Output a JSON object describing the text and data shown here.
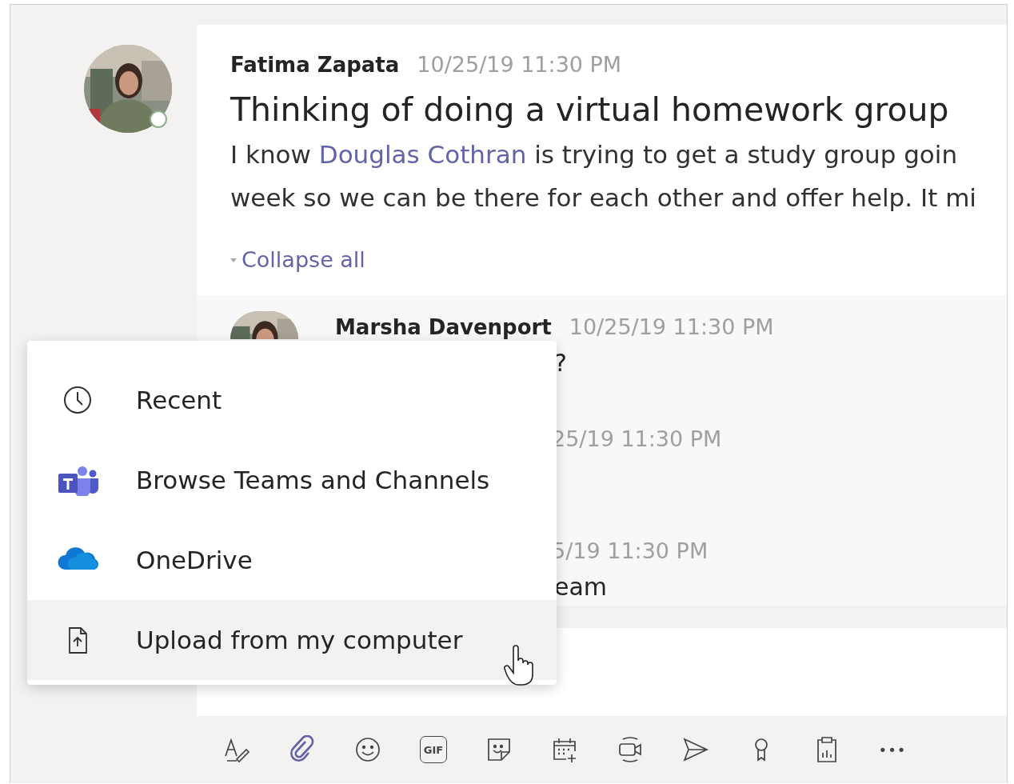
{
  "post": {
    "author": "Fatima Zapata",
    "time": "10/25/19 11:30 PM",
    "online": true,
    "title": "Thinking of doing a virtual homework group",
    "body": [
      {
        "text": "I know "
      },
      {
        "text": "Douglas Cothran",
        "kind": "mention"
      },
      {
        "text": " is trying to get a study group goin"
      }
    ],
    "body_line_2": "week so we can be there for each other and offer help. It mi",
    "collapse": "Collapse all"
  },
  "replies": [
    {
      "author": "Marsha Davenport",
      "time": "10/25/19 11:30 PM",
      "text": "?"
    },
    {
      "time": "25/19 11:30 PM"
    },
    {
      "time": "5/19 11:30 PM",
      "text": "eam"
    }
  ],
  "attach_menu": [
    {
      "kind": "clock",
      "label": "Recent",
      "selected": false
    },
    {
      "kind": "teams",
      "label": "Browse Teams and Channels",
      "selected": false
    },
    {
      "kind": "cloud",
      "label": "OneDrive",
      "selected": false
    },
    {
      "kind": "upload",
      "label": "Upload from my computer",
      "selected": true
    }
  ],
  "toolbar": [
    {
      "kind": "format",
      "selected": false
    },
    {
      "kind": "attach",
      "selected": true
    },
    {
      "kind": "emoji",
      "selected": false
    },
    {
      "kind": "gif",
      "label": "GIF",
      "selected": false
    },
    {
      "kind": "sticker",
      "selected": false
    },
    {
      "kind": "calendar",
      "selected": false
    },
    {
      "kind": "video",
      "selected": false
    },
    {
      "kind": "send",
      "selected": false
    },
    {
      "kind": "ribbon",
      "selected": false
    },
    {
      "kind": "clipboard",
      "selected": false
    },
    {
      "kind": "more",
      "label": "•••",
      "selected": false
    }
  ]
}
